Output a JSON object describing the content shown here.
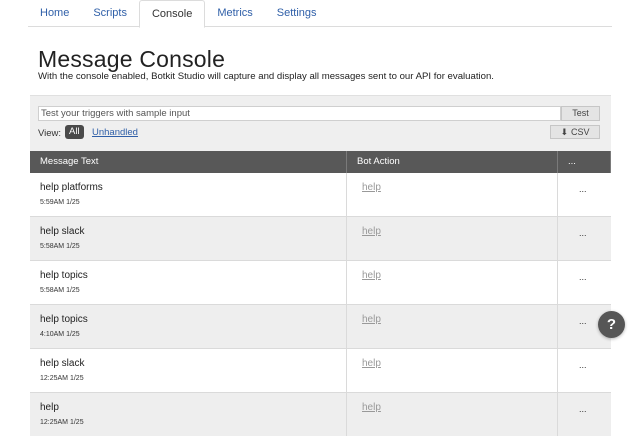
{
  "nav": {
    "tabs": [
      "Home",
      "Scripts",
      "Console",
      "Metrics",
      "Settings"
    ],
    "active": "Console"
  },
  "page": {
    "title": "Message Console",
    "description": "With the console enabled, Botkit Studio will capture and display all messages sent to our API for evaluation."
  },
  "test": {
    "placeholder": "Test your triggers with sample input",
    "button_label": "Test"
  },
  "filter": {
    "view_label": "View:",
    "all_label": "All",
    "unhandled_label": "Unhandled",
    "csv_label": "CSV"
  },
  "table": {
    "headers": [
      "Message Text",
      "Bot Action",
      "..."
    ],
    "rows": [
      {
        "message": "help platforms",
        "time": "5:59AM 1/25",
        "action": "help",
        "more": "..."
      },
      {
        "message": "help slack",
        "time": "5:58AM 1/25",
        "action": "help",
        "more": "..."
      },
      {
        "message": "help topics",
        "time": "5:58AM 1/25",
        "action": "help",
        "more": "..."
      },
      {
        "message": "help topics",
        "time": "4:10AM 1/25",
        "action": "help",
        "more": "..."
      },
      {
        "message": "help slack",
        "time": "12:25AM 1/25",
        "action": "help",
        "more": "..."
      },
      {
        "message": "help",
        "time": "12:25AM 1/25",
        "action": "help",
        "more": "..."
      }
    ]
  },
  "help_fab": "?",
  "colors": {
    "link": "#2f5fa8",
    "header_bg": "#585858",
    "panel_bg": "#efefef",
    "alt_row": "#eeeeee"
  }
}
